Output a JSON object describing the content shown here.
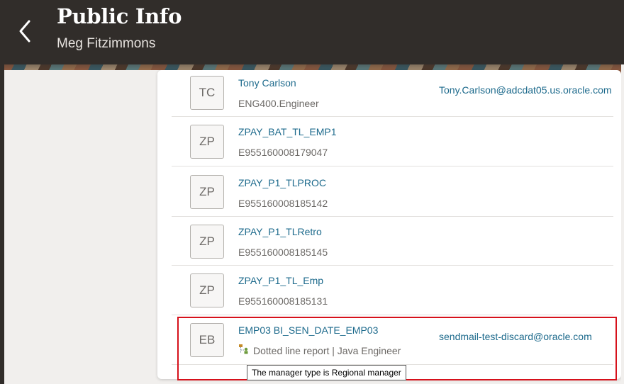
{
  "header": {
    "title": "Public Info",
    "subtitle": "Meg Fitzimmons",
    "back_icon": "chevron-left-icon"
  },
  "people": [
    {
      "initials": "TC",
      "name": "Tony Carlson",
      "detail": "ENG400.Engineer",
      "email": "Tony.Carlson@adcdat05.us.oracle.com"
    },
    {
      "initials": "ZP",
      "name": "ZPAY_BAT_TL_EMP1",
      "detail": "E955160008179047",
      "email": ""
    },
    {
      "initials": "ZP",
      "name": "ZPAY_P1_TLPROC",
      "detail": "E955160008185142",
      "email": ""
    },
    {
      "initials": "ZP",
      "name": "ZPAY_P1_TLRetro",
      "detail": "E955160008185145",
      "email": ""
    },
    {
      "initials": "ZP",
      "name": "ZPAY_P1_TL_Emp",
      "detail": "E955160008185131",
      "email": ""
    },
    {
      "initials": "EB",
      "name": "EMP03 BI_SEN_DATE_EMP03",
      "detail": "Dotted line report | Java Engineer",
      "email": "sendmail-test-discard@oracle.com",
      "detail_icon": "dotted-line-report-icon"
    }
  ],
  "tooltip": "The manager type is Regional manager",
  "colors": {
    "header_bg": "#312d2a",
    "link": "#1d6a8c",
    "highlight": "#d6111b"
  }
}
